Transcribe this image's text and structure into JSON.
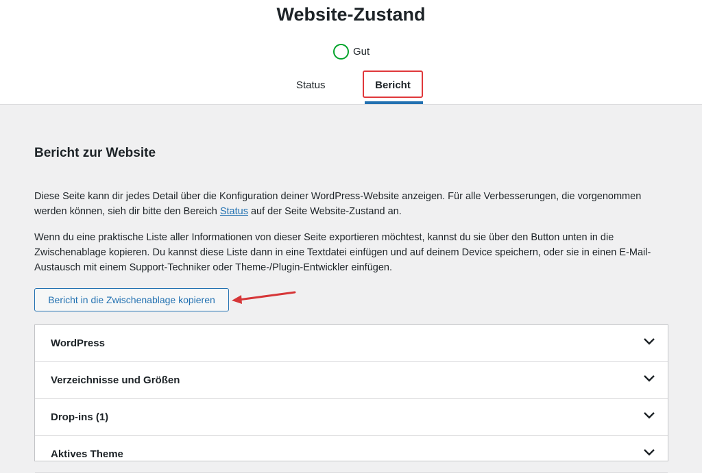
{
  "header": {
    "title": "Website-Zustand",
    "health_label": "Gut",
    "health_color": "#00a32a",
    "tabs": [
      {
        "label": "Status",
        "active": false
      },
      {
        "label": "Bericht",
        "active": true
      }
    ]
  },
  "report": {
    "title": "Bericht zur Website",
    "para1_before": "Diese Seite kann dir jedes Detail über die Konfiguration deiner WordPress-Website anzeigen. Für alle Verbesserungen, die vorgenommen werden können, sieh dir bitte den Bereich ",
    "para1_link": "Status",
    "para1_after": " auf der Seite Website-Zustand an.",
    "para2": "Wenn du eine praktische Liste aller Informationen von dieser Seite exportieren möchtest, kannst du sie über den Button unten in die Zwischenablage kopieren. Du kannst diese Liste dann in eine Textdatei einfügen und auf deinem Device speichern, oder sie in einen E-Mail-Austausch mit einem Support-Techniker oder Theme-/Plugin-Entwickler einfügen.",
    "copy_button_label": "Bericht in die Zwischenablage kopieren"
  },
  "accordion": {
    "items": [
      {
        "label": "WordPress",
        "icon": "chevron-down-icon"
      },
      {
        "label": "Verzeichnisse und Größen",
        "icon": "chevron-down-icon"
      },
      {
        "label": "Drop-ins (1)",
        "icon": "chevron-down-icon"
      },
      {
        "label": "Aktives Theme",
        "icon": "chevron-down-icon"
      }
    ]
  },
  "colors": {
    "accent": "#2271b1",
    "highlight_box": "#e0373a",
    "annotation_arrow": "#d63638"
  }
}
